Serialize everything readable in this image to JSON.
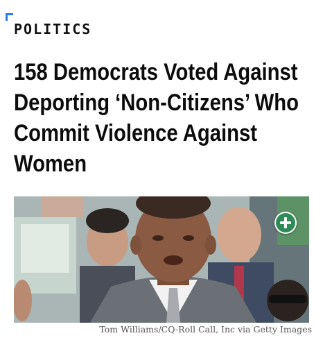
{
  "section": {
    "label": "POLITICS"
  },
  "article": {
    "headline": "158 Democrats Voted Against Deporting ‘Non-Citizens’ Who Commit Violence Against Women",
    "photo_credit": "Tom Williams/CQ-Roll Call, Inc via Getty Images"
  },
  "icons": {
    "section_marker": "corner-bracket-icon",
    "add": "plus-circle-icon"
  },
  "colors": {
    "accent": "#2b7de9",
    "add_button": "#2e8b57",
    "headline": "#0c0c0c"
  }
}
